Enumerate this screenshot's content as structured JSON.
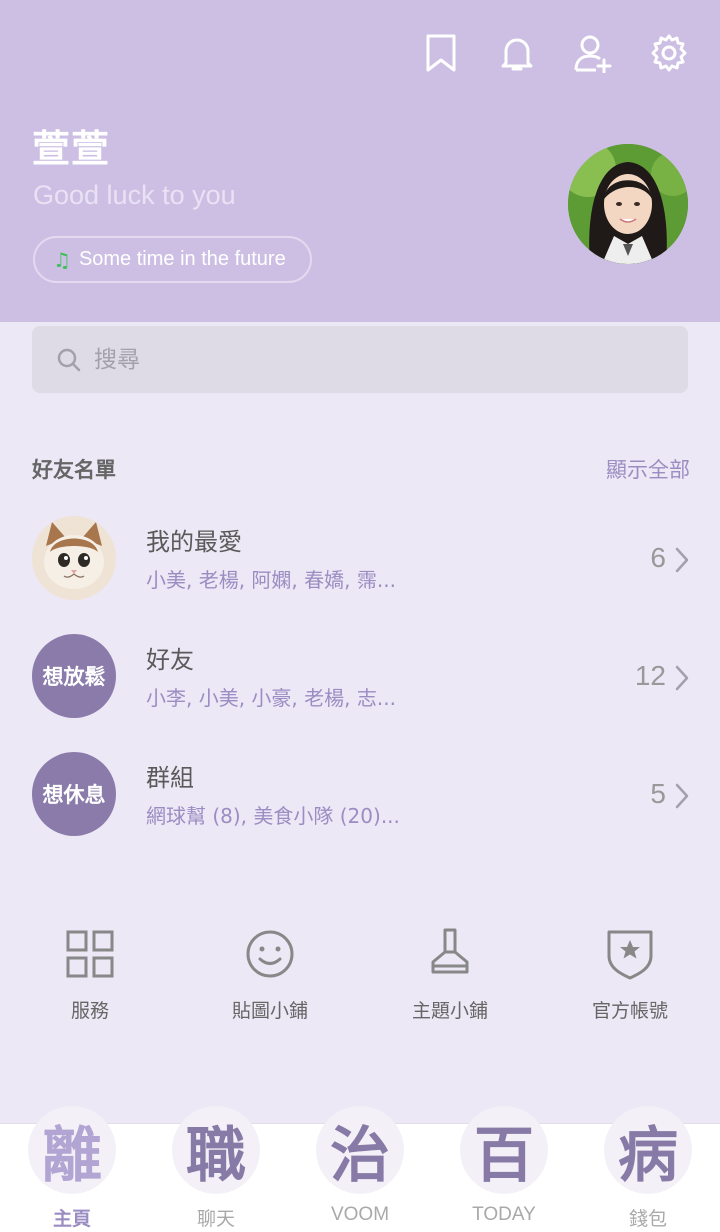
{
  "header": {
    "name": "萱萱",
    "status_message": "Good luck to you",
    "music": "Some time in the future",
    "icons": [
      "bookmark-icon",
      "bell-icon",
      "add-friend-icon",
      "settings-icon"
    ]
  },
  "search": {
    "placeholder": "搜尋"
  },
  "friends": {
    "title": "好友名單",
    "show_all": "顯示全部",
    "rows": [
      {
        "title": "我的最愛",
        "members": "小美, 老楊, 阿嫻, 春嬌, 霈...",
        "count": "6",
        "avatar_text": ""
      },
      {
        "title": "好友",
        "members": "小李, 小美, 小豪, 老楊, 志...",
        "count": "12",
        "avatar_text": "想放鬆"
      },
      {
        "title": "群組",
        "members": "網球幫 (8), 美食小隊 (20)...",
        "count": "5",
        "avatar_text": "想休息"
      }
    ]
  },
  "shortcuts": [
    {
      "label": "服務",
      "icon": "grid-icon"
    },
    {
      "label": "貼圖小鋪",
      "icon": "smiley-icon"
    },
    {
      "label": "主題小鋪",
      "icon": "brush-icon"
    },
    {
      "label": "官方帳號",
      "icon": "shield-star-icon"
    }
  ],
  "nav": [
    {
      "badge": "離",
      "label": "主頁",
      "active": true
    },
    {
      "badge": "職",
      "label": "聊天",
      "active": false
    },
    {
      "badge": "治",
      "label": "VOOM",
      "active": false
    },
    {
      "badge": "百",
      "label": "TODAY",
      "active": false
    },
    {
      "badge": "病",
      "label": "錢包",
      "active": false
    }
  ],
  "colors": {
    "header_bg": "#cdbfe4",
    "accent": "#9b8dc2",
    "page_bg": "#ece8f6",
    "avatar_bg": "#8a7bab"
  }
}
